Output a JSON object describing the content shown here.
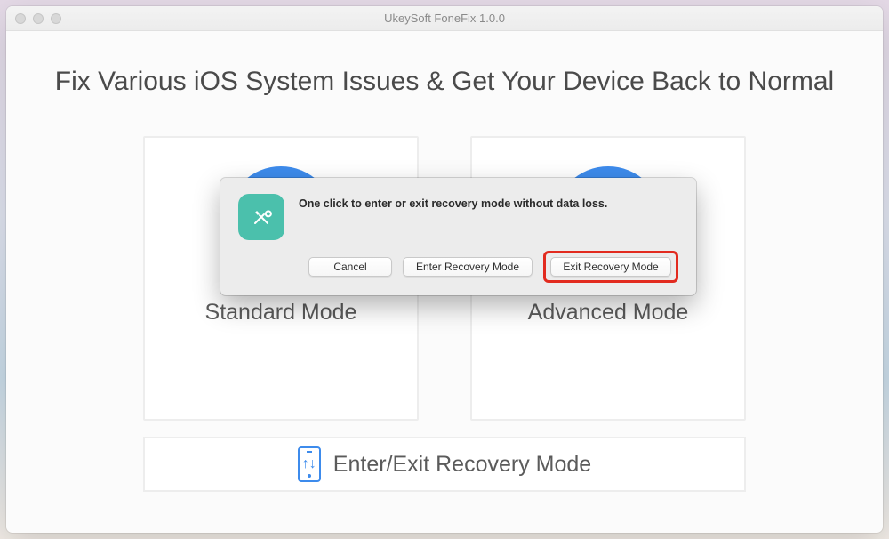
{
  "window": {
    "title": "UkeySoft FoneFix 1.0.0"
  },
  "headline": "Fix Various iOS System Issues & Get Your Device Back to Normal",
  "cards": {
    "standard": "Standard Mode",
    "advanced": "Advanced Mode"
  },
  "bottomBar": {
    "label": "Enter/Exit Recovery Mode"
  },
  "dialog": {
    "message": "One click to enter or exit recovery mode without data loss.",
    "cancel": "Cancel",
    "enter": "Enter Recovery Mode",
    "exit": "Exit Recovery Mode"
  }
}
